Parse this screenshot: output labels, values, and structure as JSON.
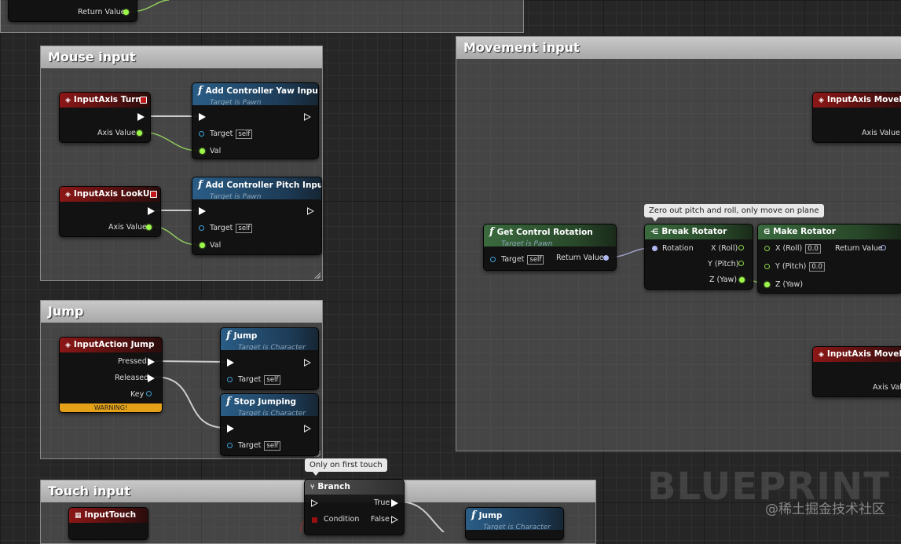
{
  "top_node": {
    "pin_return": "Return Value"
  },
  "mouse_comment": {
    "title": "Mouse input"
  },
  "movement_comment": {
    "title": "Movement input"
  },
  "jump_comment": {
    "title": "Jump"
  },
  "touch_comment": {
    "title": "Touch input"
  },
  "turn_node": {
    "title": "InputAxis Turn",
    "pin_axis": "Axis Value"
  },
  "yaw_node": {
    "title": "Add Controller Yaw Input",
    "subtitle": "Target is Pawn",
    "pin_target": "Target",
    "target_default": "self",
    "pin_val": "Val"
  },
  "lookup_node": {
    "title": "InputAxis LookUp",
    "pin_axis": "Axis Value"
  },
  "pitch_node": {
    "title": "Add Controller Pitch Input",
    "subtitle": "Target is Pawn",
    "pin_target": "Target",
    "target_default": "self",
    "pin_val": "Val"
  },
  "jump_event": {
    "title": "InputAction Jump",
    "pin_pressed": "Pressed",
    "pin_released": "Released",
    "pin_key": "Key",
    "warning": "WARNING!"
  },
  "jump_call": {
    "title": "Jump",
    "subtitle": "Target is Character",
    "pin_target": "Target",
    "target_default": "self"
  },
  "stop_jumping": {
    "title": "Stop Jumping",
    "subtitle": "Target is Character",
    "pin_target": "Target",
    "target_default": "self"
  },
  "get_control_rotation": {
    "title": "Get Control Rotation",
    "subtitle": "Target is Pawn",
    "pin_target": "Target",
    "target_default": "self",
    "pin_return": "Return Value"
  },
  "break_rotator": {
    "title": "Break Rotator",
    "pin_rotation": "Rotation",
    "pin_x": "X (Roll)",
    "pin_y": "Y (Pitch)",
    "pin_z": "Z (Yaw)",
    "comment": "Zero out pitch and roll, only move on plane"
  },
  "make_rotator": {
    "title": "Make Rotator",
    "pin_x": "X (Roll)",
    "x_default": "0.0",
    "pin_y": "Y (Pitch)",
    "y_default": "0.0",
    "pin_z": "Z (Yaw)",
    "pin_return": "Return Value"
  },
  "move_forward": {
    "title": "InputAxis MoveForward",
    "pin_axis": "Axis Value"
  },
  "move_right": {
    "title": "InputAxis MoveRight",
    "pin_axis": "Axis Value"
  },
  "input_touch": {
    "title": "InputTouch"
  },
  "branch": {
    "title": "Branch",
    "pin_true": "True",
    "pin_false": "False",
    "pin_condition": "Condition",
    "comment": "Only on first touch"
  },
  "touch_jump": {
    "title": "Jump",
    "subtitle": "Target is Character"
  },
  "watermark": {
    "logo": "BLUEPRINT",
    "site": "@稀土掘金技术社区"
  },
  "colors": {
    "event_red": "#8c1717",
    "function_blue": "#2a5d86",
    "pure_green": "#3a6a3e",
    "exec_white": "#ffffff",
    "float_green": "#9cf84a",
    "object_blue": "#3fa0d8",
    "rotator_lavender": "#b0b8f0",
    "warning_orange": "#e4a016"
  }
}
